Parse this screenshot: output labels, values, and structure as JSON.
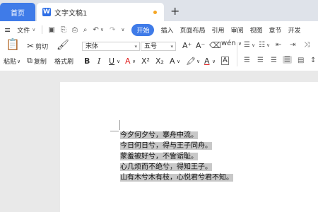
{
  "tabs": {
    "home_label": "首页",
    "doc_icon_letter": "W",
    "doc_title": "文字文稿1",
    "new_tab": "+"
  },
  "menu": {
    "file_label": "文件",
    "start_label": "开始",
    "items": [
      "插入",
      "页面布局",
      "引用",
      "审阅",
      "视图",
      "章节",
      "开发"
    ]
  },
  "ribbon": {
    "paste_label": "粘贴",
    "cut_label": "剪切",
    "copy_label": "复制",
    "format_painter_label": "格式刷",
    "font_name": "宋体",
    "font_size": "五号",
    "bold": "B",
    "italic": "I",
    "underline": "U",
    "font_color_a": "A",
    "superscript": "X²",
    "subscript": "X₂",
    "text_effect": "A",
    "char_shading": "A",
    "grow_font": "A⁺",
    "shrink_font": "A⁻",
    "pinyin": "wén"
  },
  "colors": {
    "accent": "#3f7be8",
    "selection": "#c8c8c8",
    "unsaved_dot": "#f5a623"
  },
  "document": {
    "lines": [
      "今夕何夕兮，搴舟中流。",
      "今日何日兮，得与王子同舟。",
      "蒙羞被好兮，不訾诟耻。",
      "心几烦而不绝兮，得知王子。",
      "山有木兮木有枝，心悦君兮君不知。"
    ]
  }
}
